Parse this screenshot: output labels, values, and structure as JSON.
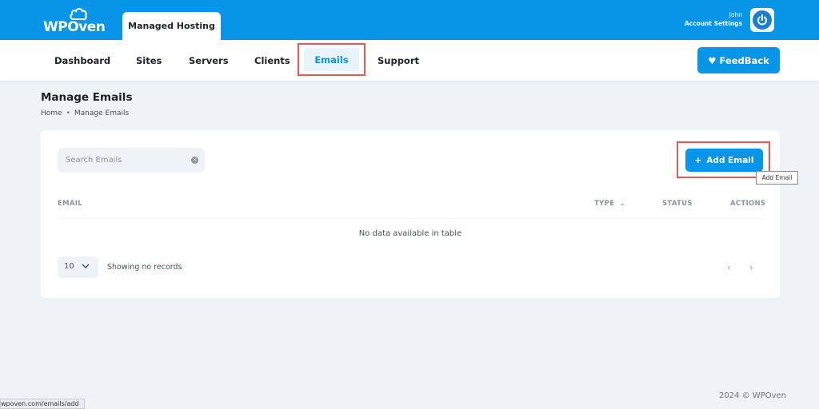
{
  "header": {
    "logo_text": "WPOven",
    "active_tab": "Managed Hosting",
    "user_name": "John",
    "account_settings": "Account Settings"
  },
  "nav": {
    "items": [
      "Dashboard",
      "Sites",
      "Servers",
      "Clients",
      "Emails",
      "Support"
    ],
    "active": "Emails",
    "feedback_label": "FeedBack"
  },
  "page": {
    "title": "Manage Emails",
    "breadcrumb": [
      "Home",
      "Manage Emails"
    ]
  },
  "toolbar": {
    "search_placeholder": "Search Emails",
    "add_label": "Add Email",
    "tooltip": "Add Email"
  },
  "table": {
    "columns": {
      "email": "EMAIL",
      "type": "TYPE",
      "status": "STATUS",
      "actions": "ACTIONS"
    },
    "empty_text": "No data available in table",
    "page_size": "10",
    "showing_text": "Showing no records"
  },
  "footer": {
    "copyright": "2024 © WPOven"
  },
  "statusbar": {
    "url": "wpoven.com/emails/add"
  },
  "colors": {
    "brand_blue": "#0795e8",
    "highlight_red": "#e05a5a",
    "background": "#eff2f7"
  }
}
